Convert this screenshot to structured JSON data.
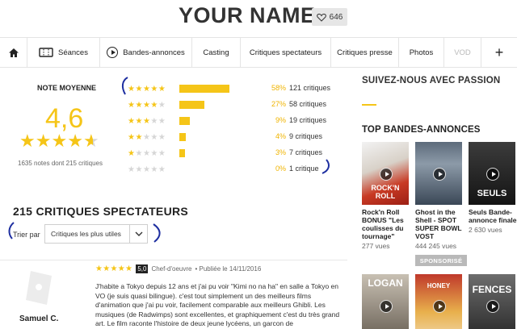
{
  "header": {
    "title": "YOUR NAME",
    "favorites_count": "646"
  },
  "nav": {
    "items": [
      {
        "label": "Séances"
      },
      {
        "label": "Bandes-annonces"
      },
      {
        "label": "Casting"
      },
      {
        "label": "Critiques spectateurs"
      },
      {
        "label": "Critiques presse"
      },
      {
        "label": "Photos"
      },
      {
        "label": "VOD"
      }
    ]
  },
  "rating": {
    "label": "NOTE MOYENNE",
    "value": "4,6",
    "stars": 4.6,
    "notes_text": "1635 notes dont 215 critiques",
    "distribution": [
      {
        "stars": 5,
        "fraction": 0.58,
        "percent": "58%",
        "count": "121 critiques"
      },
      {
        "stars": 4,
        "fraction": 0.27,
        "percent": "27%",
        "count": "58 critiques"
      },
      {
        "stars": 3,
        "fraction": 0.09,
        "percent": "9%",
        "count": "19 critiques"
      },
      {
        "stars": 2,
        "fraction": 0.04,
        "percent": "4%",
        "count": "9 critiques"
      },
      {
        "stars": 1,
        "fraction": 0.03,
        "percent": "3%",
        "count": "7 critiques"
      },
      {
        "stars": 0,
        "fraction": 0.0,
        "percent": "0%",
        "count": "1 critique"
      }
    ]
  },
  "reviews": {
    "title": "215 CRITIQUES SPECTATEURS",
    "sort_label": "Trier par",
    "sort_value": "Critiques les plus utiles",
    "first": {
      "stars": 5,
      "score": "5,0",
      "verdict": "Chef-d'oeuvre",
      "date": "• Publiée le 14/11/2016",
      "author": "Samuel C.",
      "text": "J'habite a Tokyo depuis 12 ans et j'ai pu voir \"Kimi no na ha\" en salle a Tokyo en VO (je suis quasi bilingue). c'est tout simplement un des meilleurs films d'animation que j'ai pu voir, facilement comparable aux meilleurs Ghibli. Les musiques (de Radwimps) sont excellentes, et graphiquement c'est du très grand art. Le film raconte l'histoire de deux jeune lycéens, un garcon de"
    }
  },
  "sidebar": {
    "follow_title": "SUIVEZ-NOUS AVEC PASSION",
    "top_title": "TOP BANDES-ANNONCES",
    "trailers": [
      {
        "caption": "Rock'n Roll BONUS \"Les coulisses du tournage\"",
        "views": "277 vues",
        "poster_text": "ROCK'N ROLL"
      },
      {
        "caption": "Ghost in the Shell - SPOT SUPER BOWL VOST",
        "views": "444 245 vues",
        "badge": "SPONSORISÉ",
        "poster_text": ""
      },
      {
        "caption": "Seuls Bande-annonce finale",
        "views": "2 630 vues",
        "poster_text": "SEULS"
      },
      {
        "caption": "",
        "views": "",
        "poster_text": "LOGAN"
      },
      {
        "caption": "",
        "views": "",
        "poster_text": "HONEY"
      },
      {
        "caption": "",
        "views": "",
        "poster_text": "FENCES"
      }
    ]
  },
  "colors": {
    "accent": "#f5c518",
    "annotation": "#1d2ea0"
  }
}
